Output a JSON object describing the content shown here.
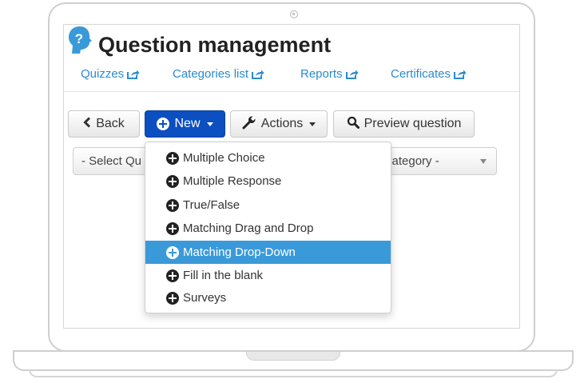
{
  "app": {
    "title": "Question management"
  },
  "nav": [
    {
      "label": "Quizzes"
    },
    {
      "label": "Categories list"
    },
    {
      "label": "Reports"
    },
    {
      "label": "Certificates"
    }
  ],
  "toolbar": {
    "back_label": "Back",
    "new_label": "New",
    "actions_label": "Actions",
    "preview_label": "Preview question"
  },
  "filters": {
    "quiz_select": "- Select Qu",
    "category_select": "category -"
  },
  "new_menu": {
    "items": [
      {
        "label": "Multiple Choice"
      },
      {
        "label": "Multiple Response"
      },
      {
        "label": "True/False"
      },
      {
        "label": "Matching Drag and Drop"
      },
      {
        "label": "Matching Drop-Down",
        "highlighted": true
      },
      {
        "label": "Fill in the blank"
      },
      {
        "label": "Surveys"
      }
    ]
  },
  "colors": {
    "link": "#2a8bd0",
    "primary_button": "#0b4fc1",
    "menu_highlight": "#3a9ad9",
    "logo": "#3a9ad9"
  },
  "icons": {
    "logo": "question-head-icon",
    "external": "external-link-icon",
    "back": "chevron-left-icon",
    "new": "plus-circle-icon",
    "actions": "wrench-icon",
    "preview": "search-icon"
  }
}
